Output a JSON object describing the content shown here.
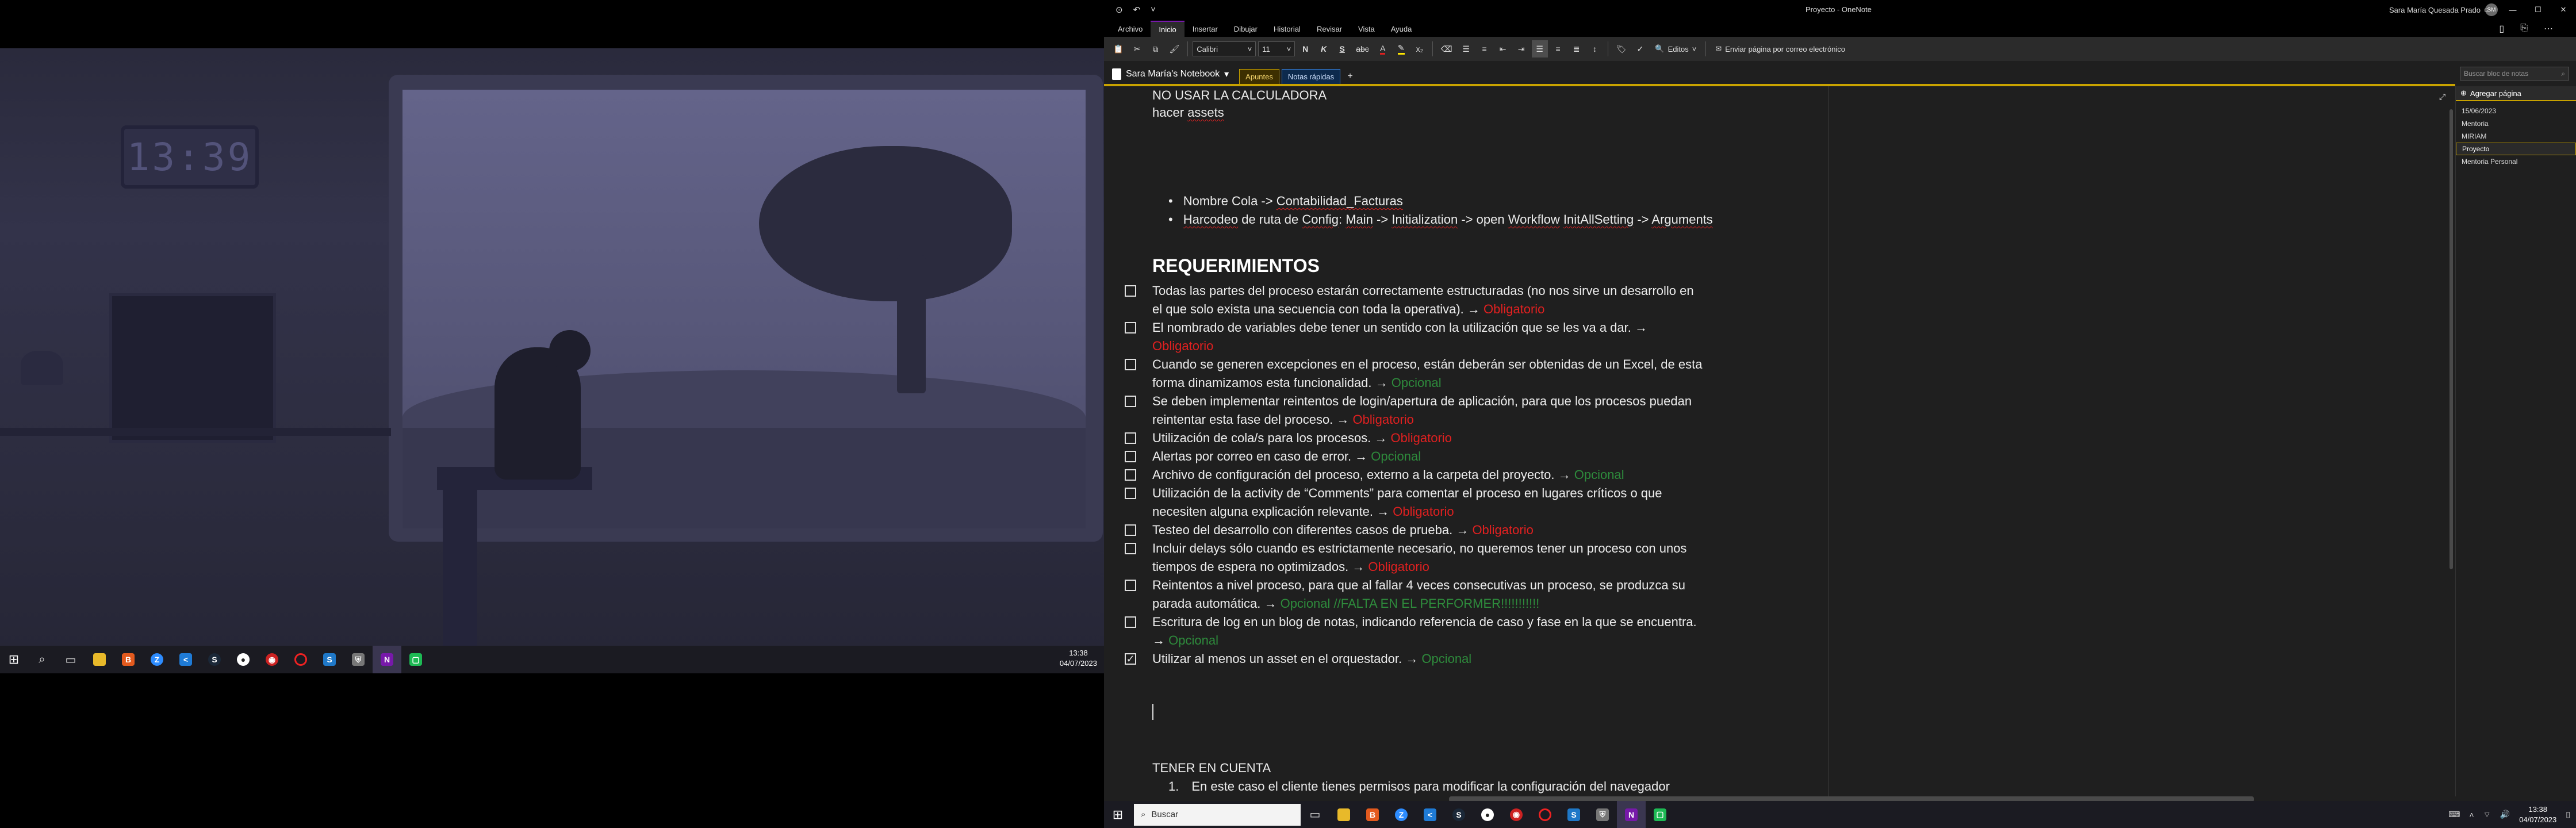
{
  "left_screen": {
    "wallpaper_clock": "13:39",
    "taskbar": {
      "icons": [
        "windows-start",
        "search",
        "task-view",
        "file-explorer",
        "brave",
        "zoom",
        "vscode",
        "steam",
        "chrome",
        "chat",
        "opera",
        "uipath-studio",
        "defender",
        "onenote",
        "app-green"
      ],
      "time": "13:38",
      "date": "04/07/2023"
    }
  },
  "window": {
    "title": "Proyecto - OneNote",
    "user_name": "Sara María Quesada Prado",
    "user_initials": "SM"
  },
  "menu_tabs": [
    "Archivo",
    "Inicio",
    "Insertar",
    "Dibujar",
    "Historial",
    "Revisar",
    "Vista",
    "Ayuda"
  ],
  "ribbon": {
    "font_name": "Calibri",
    "font_size": "11",
    "bold": "N",
    "italic": "K",
    "underline": "S",
    "strike": "abc",
    "editing_label": "Editos",
    "email_label": "Enviar página por correo electrónico"
  },
  "notebook": {
    "name": "Sara María's Notebook",
    "sections": [
      "Apuntes",
      "Notas rápidas"
    ],
    "add_section": "+",
    "search_placeholder": "Buscar bloc de notas"
  },
  "page": {
    "line1": "NO USAR LA CALCULADORA",
    "line2_a": "hacer ",
    "line2_b": "assets",
    "bullets": [
      {
        "a": "Nombre Cola -> ",
        "b": "Contabilidad_Facturas"
      },
      {
        "a": "Harcodeo",
        "b": " de ruta de ",
        "c": "Config",
        "d": ": ",
        "e": "Main",
        " f": "",
        "g": " -> ",
        "h": "Initialization",
        "i": " -> open ",
        "j": "Workflow",
        "k": " ",
        "l": "InitAllSetting",
        "m": " -> ",
        "n": "Arguments"
      }
    ],
    "heading": "REQUERIMIENTOS",
    "reqs": [
      {
        "t1": "Todas las partes del proceso estarán correctamente estructuradas (no nos sirve un desarrollo en",
        "t2": "el que solo exista una secuencia con toda la operativa). → ",
        "tag": "Obligatorio"
      },
      {
        "t1": "El nombrado de variables debe tener un sentido con la utilización que se les va a dar. →",
        "t2": "",
        "tag": "Obligatorio"
      },
      {
        "t1": "Cuando se generen excepciones en el proceso, están deberán ser obtenidas de un Excel, de esta",
        "t2": "forma dinamizamos esta funcionalidad. → ",
        "tag": "Opcional"
      },
      {
        "t1": "Se deben implementar reintentos de login/apertura de aplicación, para que los procesos puedan",
        "t2": "reintentar esta fase del proceso. → ",
        "tag": "Obligatorio"
      },
      {
        "t1": "Utilización de cola/s para los procesos. → ",
        "tag": "Obligatorio"
      },
      {
        "t1": " Alertas por correo en caso de error. → ",
        "tag": "Opcional"
      },
      {
        "t1": " Archivo de configuración del proceso, externo a la carpeta del proyecto. → ",
        "tag": "Opcional"
      },
      {
        "t1": "Utilización de la activity de “Comments” para comentar el proceso en lugares críticos o que",
        "t2": "necesiten alguna explicación relevante. → ",
        "tag": "Obligatorio"
      },
      {
        "t1": "Testeo del desarrollo con diferentes casos de prueba. → ",
        "tag": "Obligatorio"
      },
      {
        "t1": "Incluir delays sólo cuando es estrictamente necesario, no queremos tener un proceso con unos",
        "t2": "tiempos de espera no optimizados. → ",
        "tag": "Obligatorio"
      },
      {
        "t1": "Reintentos a nivel proceso, para que al fallar 4 veces consecutivas un proceso, se produzca su",
        "t2": "parada automática. → ",
        "tag": "Opcional //FALTA EN EL PERFORMER!!!!!!!!!!!"
      },
      {
        "t1": "Escritura de log en un blog de notas, indicando referencia de caso y fase en la que se encuentra.",
        "t2": "→ ",
        "tag": "Opcional"
      },
      {
        "t1": " Utilizar al menos un asset en el orquestador. → ",
        "tag": "Opcional"
      }
    ],
    "checked_index": 12,
    "footer_heading": "TENER EN CUENTA",
    "footer_item_num": "1.",
    "footer_item": "En este caso el cliente tienes permisos para modificar la configuración del navegador"
  },
  "page_list": {
    "add_page": "Agregar página",
    "pages": [
      "15/06/2023",
      "Mentoria",
      "MIRIAM",
      "Proyecto",
      "Mentoria Personal"
    ],
    "selected": 3
  },
  "right_taskbar": {
    "search_placeholder": "Buscar",
    "time": "13:38",
    "date": "04/07/2023"
  },
  "colors": {
    "required": "#e02020",
    "optional": "#2e8b3c",
    "section_accent": "#c8a200",
    "onenote_purple": "#7719aa"
  }
}
